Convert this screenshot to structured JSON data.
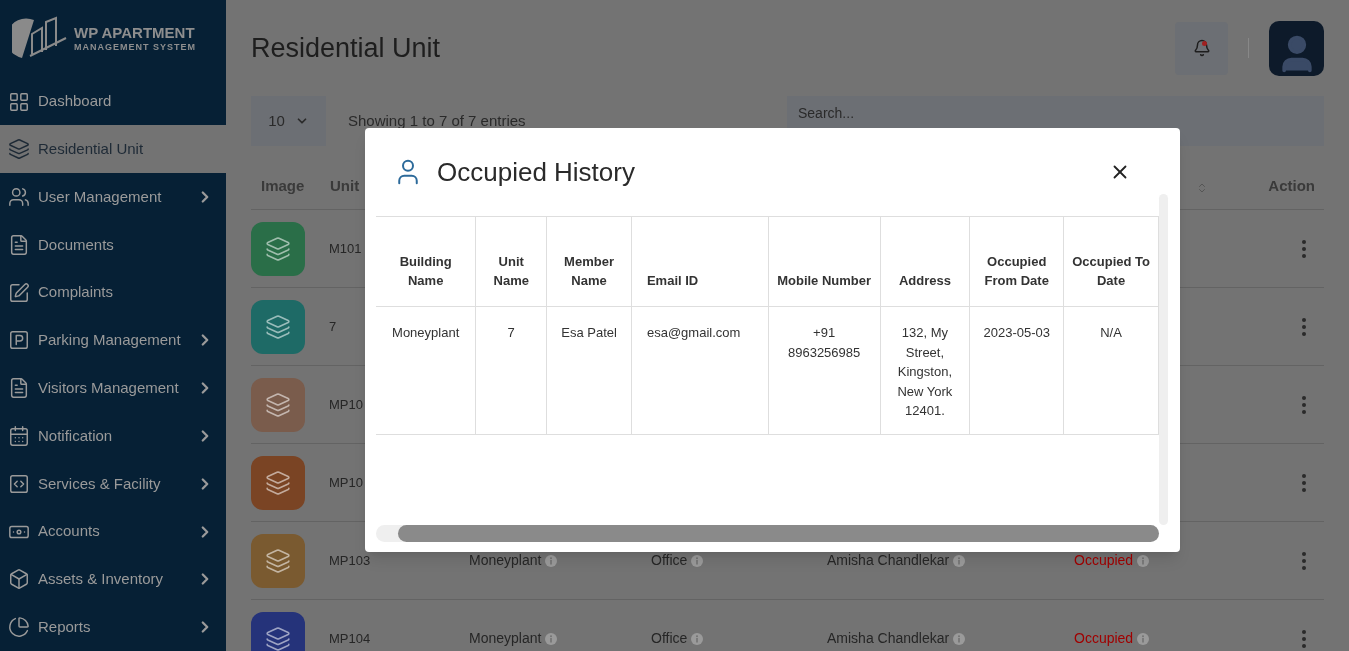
{
  "logo": {
    "title": "WP APARTMENT",
    "subtitle": "MANAGEMENT SYSTEM"
  },
  "sidebar": {
    "items": [
      {
        "label": "Dashboard",
        "selected": false,
        "expandable": false
      },
      {
        "label": "Residential Unit",
        "selected": true,
        "expandable": false
      },
      {
        "label": "User Management",
        "selected": false,
        "expandable": true
      },
      {
        "label": "Documents",
        "selected": false,
        "expandable": false
      },
      {
        "label": "Complaints",
        "selected": false,
        "expandable": false
      },
      {
        "label": "Parking Management",
        "selected": false,
        "expandable": true
      },
      {
        "label": "Visitors Management",
        "selected": false,
        "expandable": true
      },
      {
        "label": "Notification",
        "selected": false,
        "expandable": true
      },
      {
        "label": "Services & Facility",
        "selected": false,
        "expandable": true
      },
      {
        "label": "Accounts",
        "selected": false,
        "expandable": true
      },
      {
        "label": "Assets & Inventory",
        "selected": false,
        "expandable": true
      },
      {
        "label": "Reports",
        "selected": false,
        "expandable": true
      }
    ]
  },
  "page_title": "Residential Unit",
  "notifications": {
    "unread": true
  },
  "page_size": "10",
  "entries_info": "Showing 1 to 7 of 7 entries",
  "search": {
    "placeholder": "Search..."
  },
  "table": {
    "columns": [
      "Image",
      "Unit",
      "Action"
    ],
    "rows": [
      {
        "color": "#2a6e48",
        "unit_name": "M101"
      },
      {
        "color": "#1e6a66",
        "unit_name": "7"
      },
      {
        "color": "#7a5c4c",
        "unit_name": "MP10"
      },
      {
        "color": "#7a4424",
        "unit_name": "MP10"
      },
      {
        "color": "#7a5a30",
        "unit_name": "MP103",
        "building": "Moneyplant",
        "type": "Office",
        "member": "Amisha Chandlekar",
        "status": "Occupied"
      },
      {
        "color": "#25337a",
        "unit_name": "MP104",
        "building": "Moneyplant",
        "type": "Office",
        "member": "Amisha Chandlekar",
        "status": "Occupied"
      }
    ]
  },
  "modal": {
    "title": "Occupied History",
    "columns": [
      "Building Name",
      "Unit Name",
      "Member Name",
      "Email ID",
      "Mobile Number",
      "Address",
      "Occupied From Date",
      "Occupied To Date"
    ],
    "rows": [
      [
        "Moneyplant",
        "7",
        "Esa Patel",
        "esa@gmail.com",
        "+91 8963256985",
        "132, My Street, Kingston, New York 12401.",
        "2023-05-03",
        "N/A"
      ]
    ]
  }
}
